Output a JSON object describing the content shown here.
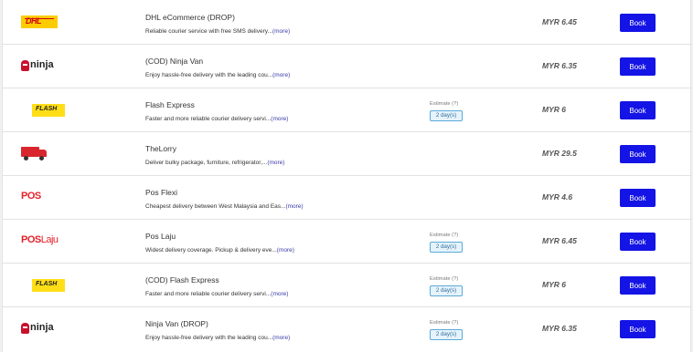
{
  "currency_label": "MYR",
  "couriers": [
    {
      "name": "DHL eCommerce (DROP)",
      "desc": "Reliable courier service with free SMS delivery...",
      "more": "(more)",
      "estimate_label": "",
      "estimate": "",
      "price": "MYR 6.45",
      "book": "Book",
      "logo": "dhl-logo",
      "logo_text": "DHL"
    },
    {
      "name": "(COD) Ninja Van",
      "desc": "Enjoy hassle-free delivery with the leading cou...",
      "more": "(more)",
      "estimate_label": "",
      "estimate": "",
      "price": "MYR 6.35",
      "book": "Book",
      "logo": "ninja-logo",
      "logo_text": "ninja"
    },
    {
      "name": "Flash Express",
      "desc": "Faster and more reliable courier delivery servi...",
      "more": "(more)",
      "estimate_label": "Estimate (?)",
      "estimate": "2 day(s)",
      "price": "MYR 6",
      "book": "Book",
      "logo": "flash-logo",
      "logo_text": "FLASH"
    },
    {
      "name": "TheLorry",
      "desc": "Deliver bulky package, furniture, refrigerator,...",
      "more": "(more)",
      "estimate_label": "",
      "estimate": "",
      "price": "MYR 29.5",
      "book": "Book",
      "logo": "lorry-logo",
      "logo_text": ""
    },
    {
      "name": "Pos Flexi",
      "desc": "Cheapest delivery between West Malaysia and Eas...",
      "more": "(more)",
      "estimate_label": "",
      "estimate": "",
      "price": "MYR 4.6",
      "book": "Book",
      "logo": "pos-logo",
      "logo_text": "POS"
    },
    {
      "name": "Pos Laju",
      "desc": "Widest delivery coverage. Pickup & delivery eve...",
      "more": "(more)",
      "estimate_label": "Estimate (?)",
      "estimate": "2 day(s)",
      "price": "MYR 6.45",
      "book": "Book",
      "logo": "poslaju-logo",
      "logo_text": "POS Laju"
    },
    {
      "name": "(COD) Flash Express",
      "desc": "Faster and more reliable courier delivery servi...",
      "more": "(more)",
      "estimate_label": "Estimate (?)",
      "estimate": "2 day(s)",
      "price": "MYR 6",
      "book": "Book",
      "logo": "flash-logo",
      "logo_text": "FLASH"
    },
    {
      "name": "Ninja Van (DROP)",
      "desc": "Enjoy hassle-free delivery with the leading cou...",
      "more": "(more)",
      "estimate_label": "Estimate (?)",
      "estimate": "2 day(s)",
      "price": "MYR 6.35",
      "book": "Book",
      "logo": "ninja-logo",
      "logo_text": "ninja"
    }
  ],
  "colors": {
    "book_button": "#1414e6",
    "price_text": "#555555",
    "more_link": "#3a3aa8"
  }
}
